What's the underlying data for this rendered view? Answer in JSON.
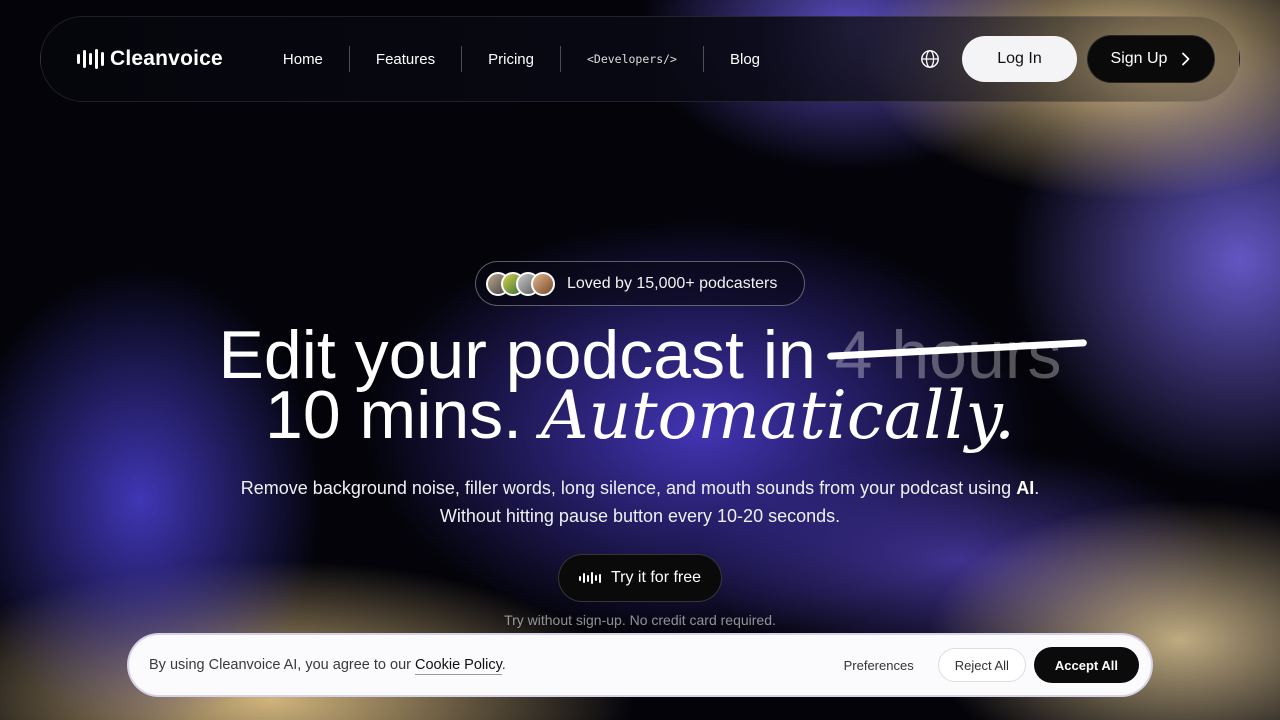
{
  "brand": {
    "name": "Cleanvoice"
  },
  "nav": {
    "items": [
      {
        "label": "Home"
      },
      {
        "label": "Features"
      },
      {
        "label": "Pricing"
      },
      {
        "label": "<Developers/>"
      },
      {
        "label": "Blog"
      }
    ],
    "login_label": "Log In",
    "signup_label": "Sign Up"
  },
  "hero": {
    "badge_text": "Loved by 15,000+ podcasters",
    "headline_line1": "Edit your podcast in ",
    "headline_struck": "4 hours",
    "headline_line2": "10 mins. ",
    "headline_italic": "Automatically.",
    "subtitle_before": "Remove background noise, filler words, long silence, and mouth sounds from your podcast using ",
    "subtitle_bold": "AI",
    "subtitle_after": ".",
    "subtitle_line2": "Without hitting pause button every 10-20 seconds.",
    "cta_label": "Try it for free",
    "note": "Try without sign-up. No credit card required."
  },
  "cookie": {
    "text": "By using Cleanvoice AI, you agree to our ",
    "link_label": "Cookie Policy",
    "text_end": ".",
    "preferences_label": "Preferences",
    "reject_label": "Reject All",
    "accept_label": "Accept All"
  },
  "colors": {
    "accent_purple": "#4a3ad0",
    "accent_gold": "#e6c98f",
    "background": "#030309"
  }
}
